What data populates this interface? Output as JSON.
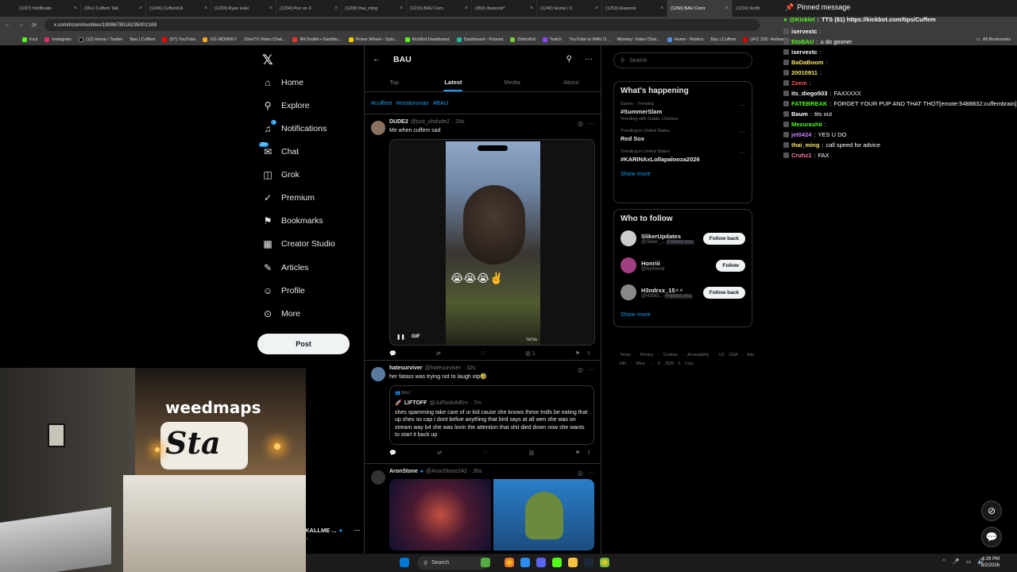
{
  "browser": {
    "tabs": [
      {
        "label": "(1197) Notificatio"
      },
      {
        "label": "(99+) Cuffem Taki"
      },
      {
        "label": "(1246) CuffemKA"
      },
      {
        "label": "(1203) Ryan Huki"
      },
      {
        "label": "(1204) Poo on X"
      },
      {
        "label": "(1209) thai_ming"
      },
      {
        "label": "(1216) BAU Com"
      },
      {
        "label": "(950) diamond*"
      },
      {
        "label": "(1240) Home / X"
      },
      {
        "label": "(1253) kliasmok"
      },
      {
        "label": "(1256) BAU Comr"
      },
      {
        "label": "(1216) Notifi"
      }
    ],
    "active_tab": 10,
    "url": "x.com/i/communities/1908678516235002169",
    "bookmarks": [
      "Kick",
      "Instagram",
      "(12) Home / Twitter",
      "Bau | Cuffem",
      "(57) YouTube",
      "OG MONKEY",
      "OmeTV Video Chat...",
      "IRLToolkit • Dashbo...",
      "Picker Wheel - Spin...",
      "KickBot Dashboard",
      "Dashboard - Pulsoid",
      "DistroKid",
      "Twitch",
      "YouTube to WAV D...",
      "Monkey: Video Chat...",
      "Home - Roblox",
      "Bau | Cuffem",
      "UFC 326: Holloway...",
      "All Bookmarks"
    ]
  },
  "nav": {
    "items": [
      "Home",
      "Explore",
      "Notifications",
      "Chat",
      "Grok",
      "Premium",
      "Bookmarks",
      "Creator Studio",
      "Articles",
      "Profile",
      "More"
    ],
    "notif_badge": "1",
    "chat_badge": "20+",
    "post_label": "Post",
    "account_name": "KALLME ...",
    "account_handle": "n"
  },
  "community": {
    "title": "BAU",
    "tabs": [
      "Top",
      "Latest",
      "Media",
      "About"
    ],
    "selected_tab": "Latest",
    "hashtags": [
      "#cuffem",
      "#motionman",
      "#BAU"
    ]
  },
  "tweets": [
    {
      "name": "DUDE2",
      "handle": "@just_uhdude2",
      "time": "· 28s",
      "text": "Me when cuffem sad",
      "media_label": "GIF",
      "media_emojis": "😭😭😭✌️",
      "media_tag": "TikTok",
      "views": "1"
    },
    {
      "name": "hatesurviver",
      "handle": "@hatesurviver",
      "time": "· 32s",
      "text": "her fatass was trying not to laugh otp🤣",
      "quote": {
        "community": "BAU",
        "name": "LIFTOFF",
        "handle": "@JuFlockAtEm",
        "time": "· 7m",
        "text": "shes spamming take care of ur kid cause she knows these trolls be eating that up shes so cap I dont belive anything that bird says at all wen she was on stream way b4 she was lovin the attention that shit died down now she wants to start it back up"
      }
    },
    {
      "name": "AronStone",
      "handle": "@AronStone242",
      "time": "· 36s"
    }
  ],
  "right": {
    "search_placeholder": "Search",
    "happening_title": "What's happening",
    "trends": [
      {
        "meta": "Sports · Trending",
        "title": "#SummerSlam",
        "sub": "Trending with Gable, Chelsea"
      },
      {
        "meta": "Trending in United States",
        "title": "Red Sox",
        "sub": ""
      },
      {
        "meta": "Trending in United States",
        "title": "#KARINAxLollapalooza2026",
        "sub": ""
      }
    ],
    "show_more": "Show more",
    "follow_title": "Who to follow",
    "follows": [
      {
        "name": "SlikerUpdates",
        "handle": "@Sliker_...",
        "follows_you": "Follows you",
        "button": "Follow back"
      },
      {
        "name": "Honriii",
        "handle": "@ItsHonriii",
        "follows_you": "",
        "button": "Follow"
      },
      {
        "name": "H3ndrxx_15⚡⚡",
        "handle": "@H3ND...",
        "follows_you": "Follows you",
        "button": "Follow back"
      }
    ],
    "footer": "Terms · Privacy · Cookies · Accessibility · US 110A · Ads info · More ··· © 2026 X Corp."
  },
  "chat": {
    "pinned_title": "Pinned message",
    "pinned_user": "@Kicklet",
    "pinned_text": "TTS ($1) https://kickbot.com/tips/Cuffem",
    "lines": [
      {
        "user": "iservextc",
        "text": "",
        "color": "#ffffff"
      },
      {
        "user": "EtoBAU",
        "text": "u do gooner",
        "color": "#53fc18"
      },
      {
        "user": "iservextc",
        "text": "",
        "color": "#ffffff"
      },
      {
        "user": "BaDaBoom",
        "text": "",
        "color": "#f5e663"
      },
      {
        "user": "20010911",
        "text": "",
        "color": "#f5e663"
      },
      {
        "user": "Zeem",
        "text": "",
        "color": "#ff5050"
      },
      {
        "user": "its_diego503",
        "text": "FAXXXXX",
        "color": "#ffffff"
      },
      {
        "user": "FATEBREAK",
        "text": "FORGET YOUR PUP AND THAT THOT[emote:5488832:cuffembrain]",
        "color": "#53fc18"
      },
      {
        "user": "Baum",
        "text": "tits out",
        "color": "#ffffff"
      },
      {
        "user": "Mezurashii",
        "text": "",
        "color": "#53fc18"
      },
      {
        "user": "jet0424",
        "text": "YES U DO",
        "color": "#c77dff"
      },
      {
        "user": "thai_ming",
        "text": "call speed for advice",
        "color": "#f5e663"
      },
      {
        "user": "Cruhz1",
        "text": "FAX",
        "color": "#ff7aa8"
      }
    ]
  },
  "webcam": {
    "headboard_text": "weedmaps",
    "pillow_text": "Sta"
  },
  "taskbar": {
    "search_label": "Search",
    "time": "4:29 PM",
    "date": "8/2/2026"
  }
}
